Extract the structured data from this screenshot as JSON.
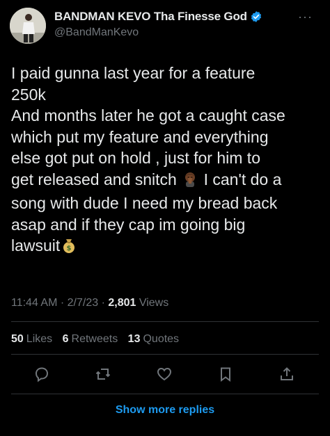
{
  "user": {
    "display_name": "BANDMAN KEVO Tha Finesse God",
    "handle": "@BandManKevo",
    "verified": true,
    "more_label": "···"
  },
  "tweet": {
    "lines": [
      "I paid gunna last year for a feature",
      "250k",
      "And months later he got a caught case",
      "which put my feature and everything",
      "else got put on hold , just for him to",
      "get released and snitch",
      "I can't do a",
      "song with dude I need my bread back",
      "asap and if they cap im going big",
      "lawsuit"
    ],
    "emoji_1": "person-facepalming-emoji",
    "emoji_2": "money-bag-emoji"
  },
  "meta": {
    "time": "11:44 AM",
    "sep1": " · ",
    "date": "2/7/23",
    "sep2": " · ",
    "views_count": "2,801",
    "views_label": "Views"
  },
  "stats": {
    "likes_count": "50",
    "likes_label": "Likes",
    "retweets_count": "6",
    "retweets_label": "Retweets",
    "quotes_count": "13",
    "quotes_label": "Quotes"
  },
  "actions": [
    "reply-icon",
    "retweet-icon",
    "like-icon",
    "bookmark-icon",
    "share-icon"
  ],
  "show_more_replies": "Show more replies",
  "colors": {
    "background": "#000000",
    "text": "#e7e9ea",
    "secondary": "#71767b",
    "accent": "#1d9bf0",
    "divider": "#2f3336"
  }
}
